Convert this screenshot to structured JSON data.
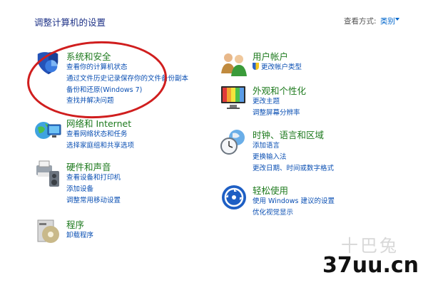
{
  "header": {
    "title": "调整计算机的设置",
    "view_by_label": "查看方式:",
    "view_by_value": "类别"
  },
  "categories": {
    "system": {
      "title": "系统和安全",
      "links": [
        "查看你的计算机状态",
        "通过文件历史记录保存你的文件备份副本",
        "备份和还原(Windows 7)",
        "查找并解决问题"
      ]
    },
    "network": {
      "title": "网络和 Internet",
      "links": [
        "查看网络状态和任务",
        "选择家庭组和共享选项"
      ]
    },
    "hardware": {
      "title": "硬件和声音",
      "links": [
        "查看设备和打印机",
        "添加设备",
        "调整常用移动设置"
      ]
    },
    "programs": {
      "title": "程序",
      "links": [
        "卸载程序"
      ]
    },
    "users": {
      "title": "用户帐户",
      "links": [
        "更改帐户类型"
      ]
    },
    "appearance": {
      "title": "外观和个性化",
      "links": [
        "更改主题",
        "调整屏幕分辨率"
      ]
    },
    "clock": {
      "title": "时钟、语言和区域",
      "links": [
        "添加语言",
        "更换输入法",
        "更改日期、时间或数字格式"
      ]
    },
    "ease": {
      "title": "轻松使用",
      "links": [
        "使用 Windows 建议的设置",
        "优化视觉显示"
      ]
    }
  },
  "watermark": {
    "cn": "十巴兔",
    "site": "37uu.cn"
  },
  "colors": {
    "category_title": "#1e7a1e",
    "link": "#0a4fb3",
    "annotation": "#d01e1e"
  }
}
